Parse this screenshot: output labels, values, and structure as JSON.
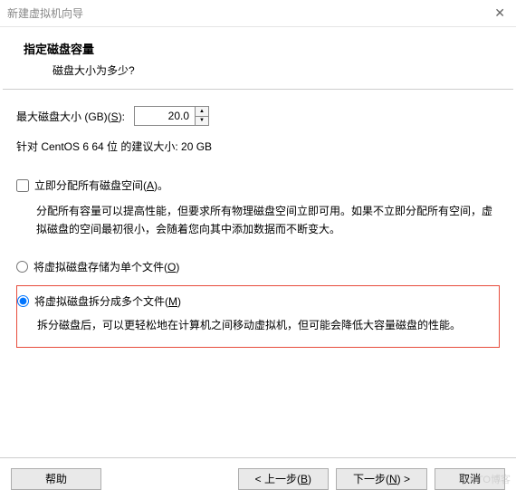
{
  "window": {
    "title": "新建虚拟机向导"
  },
  "header": {
    "title": "指定磁盘容量",
    "subtitle": "磁盘大小为多少?"
  },
  "disk": {
    "size_label_pre": "最大磁盘大小 (GB)(",
    "size_label_key": "S",
    "size_label_post": "):",
    "size_value": "20.0",
    "recommend": "针对 CentOS 6 64 位 的建议大小: 20 GB"
  },
  "allocate": {
    "label_pre": "立即分配所有磁盘空间(",
    "label_key": "A",
    "label_post": ")。",
    "desc": "分配所有容量可以提高性能，但要求所有物理磁盘空间立即可用。如果不立即分配所有空间，虚拟磁盘的空间最初很小，会随着您向其中添加数据而不断变大。"
  },
  "store_single": {
    "label_pre": "将虚拟磁盘存储为单个文件(",
    "label_key": "O",
    "label_post": ")"
  },
  "store_multi": {
    "label_pre": "将虚拟磁盘拆分成多个文件(",
    "label_key": "M",
    "label_post": ")",
    "desc": "拆分磁盘后，可以更轻松地在计算机之间移动虚拟机，但可能会降低大容量磁盘的性能。"
  },
  "footer": {
    "help": "帮助",
    "back_pre": "< 上一步(",
    "back_key": "B",
    "back_post": ")",
    "next_pre": "下一步(",
    "next_key": "N",
    "next_post": ") >",
    "cancel": "取消"
  },
  "watermark": "51CTO博客"
}
